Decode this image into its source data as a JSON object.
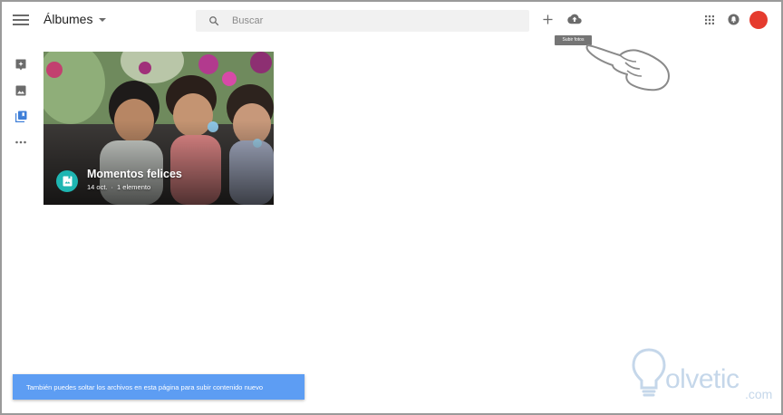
{
  "header": {
    "title": "Álbumes",
    "search_placeholder": "Buscar",
    "upload_tooltip": "Subir fotos"
  },
  "album": {
    "title": "Momentos felices",
    "date": "14 oct.",
    "separator": "·",
    "count": "1 elemento"
  },
  "snackbar": {
    "text": "También puedes soltar los archivos en esta página para subir contenido nuevo"
  },
  "watermark": {
    "brand": "olvetic",
    "suffix": ".com"
  },
  "icons": {
    "menu": "menu-icon",
    "search": "search-icon",
    "plus": "plus-icon",
    "upload": "cloud-upload-icon",
    "apps": "apps-grid-icon",
    "notifications": "notifications-icon",
    "rail": [
      "assistant-icon",
      "photos-icon",
      "albums-icon",
      "more-icon"
    ],
    "album_badge": "album-icon"
  },
  "colors": {
    "avatar": "#e53b2e",
    "album_badge": "#1eb6b2",
    "snackbar": "#5d9df3",
    "active_rail": "#3f7fd8"
  }
}
